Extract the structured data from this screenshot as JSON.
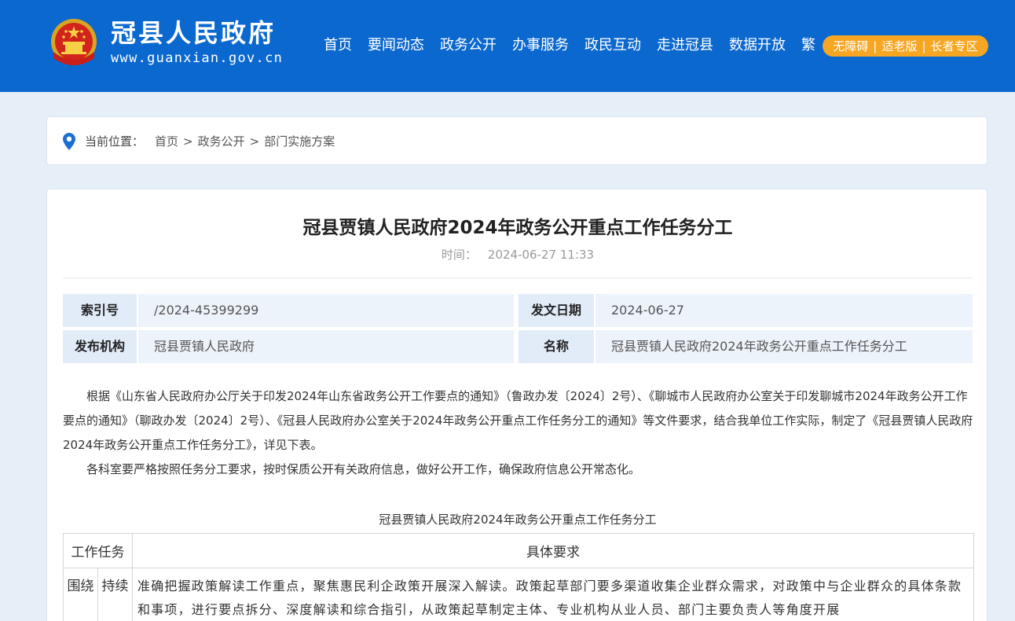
{
  "header": {
    "site_name": "冠县人民政府",
    "site_url": "www.guanxian.gov.cn",
    "nav": [
      "首页",
      "要闻动态",
      "政务公开",
      "办事服务",
      "政民互动",
      "走进冠县",
      "数据开放",
      "繁"
    ],
    "access": [
      "无障碍",
      "适老版",
      "长者专区"
    ],
    "access_separator": "|"
  },
  "breadcrumb": {
    "label": "当前位置：",
    "items": [
      "首页",
      "政务公开",
      "部门实施方案"
    ],
    "separator": ">"
  },
  "article": {
    "title": "冠县贾镇人民政府2024年政务公开重点工作任务分工",
    "time_label": "时间：",
    "time_value": "2024-06-27 11:33",
    "meta": {
      "index_label": "索引号",
      "index_value": "/2024-45399299",
      "date_label": "发文日期",
      "date_value": "2024-06-27",
      "org_label": "发布机构",
      "org_value": "冠县贾镇人民政府",
      "name_label": "名称",
      "name_value": "冠县贾镇人民政府2024年政务公开重点工作任务分工"
    },
    "paragraphs": [
      "根据《山东省人民政府办公厅关于印发2024年山东省政务公开工作要点的通知》（鲁政办发〔2024〕2号）、《聊城市人民政府办公室关于印发聊城市2024年政务公开工作要点的通知》（聊政办发〔2024〕2号）、《冠县人民政府办公室关于2024年政务公开重点工作任务分工的通知》等文件要求，结合我单位工作实际，制定了《冠县贾镇人民政府2024年政务公开重点工作任务分工》，详见下表。",
      "各科室要严格按照任务分工要求，按时保质公开有关政府信息，做好公开工作，确保政府信息公开常态化。"
    ],
    "table": {
      "caption": "冠县贾镇人民政府2024年政务公开重点工作任务分工",
      "head_task": "工作任务",
      "head_req": "具体要求",
      "row1_col1": "围绕",
      "row1_col2": "持续",
      "row1_desc": "准确把握政策解读工作重点，聚焦惠民利企政策开展深入解读。政策起草部门要多渠道收集企业群众需求，对政策中与企业群众的具体条款和事项，进行要点拆分、深度解读和综合指引，从政策起草制定主体、专业机构从业人员、部门主要负责人等角度开展"
    }
  },
  "colors": {
    "header_bg": "#0b68cf",
    "accent_orange": "#f6a623",
    "page_bg": "#e6eef8",
    "meta_key_bg": "#e1ecf8",
    "meta_val_bg": "#edf3fb"
  },
  "icons": {
    "emblem": "national-emblem-icon",
    "location": "location-pin-icon"
  }
}
